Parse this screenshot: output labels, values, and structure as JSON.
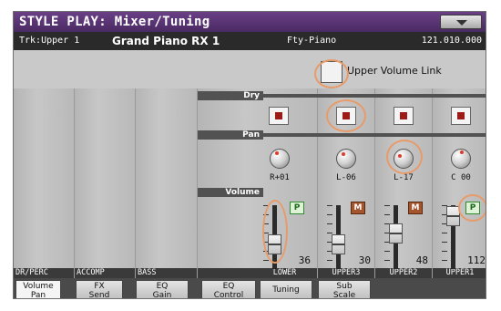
{
  "title": "STYLE PLAY: Mixer/Tuning",
  "info": {
    "track": "Trk:Upper 1",
    "sound": "Grand Piano RX 1",
    "bank": "Fty-Piano",
    "number": "121.010.000"
  },
  "upper_volume_link": "Upper Volume Link",
  "sections": {
    "dry": "Dry",
    "pan": "Pan",
    "volume": "Volume"
  },
  "channels": [
    {
      "name": "DR/PERC"
    },
    {
      "name": "ACCOMP"
    },
    {
      "name": "BASS"
    },
    {
      "name": "LOWER",
      "volume": "36",
      "button": "P"
    },
    {
      "name": "UPPER3",
      "pan": "L-06",
      "volume": "30",
      "button": "M"
    },
    {
      "name": "UPPER2",
      "pan": "L-17",
      "volume": "48",
      "button": "M"
    },
    {
      "name": "UPPER1",
      "pan": "C 00",
      "volume": "112",
      "button": "P"
    }
  ],
  "lower_pan": "R+01",
  "tabs": [
    {
      "line1": "Volume",
      "line2": "Pan"
    },
    {
      "line1": "FX",
      "line2": "Send"
    },
    {
      "line1": "EQ",
      "line2": "Gain"
    },
    {
      "line1": "EQ",
      "line2": "Control"
    },
    {
      "line1": "Tuning",
      "line2": ""
    },
    {
      "line1": "Sub",
      "line2": "Scale"
    }
  ],
  "colors": {
    "title_bar": "#5a3575",
    "highlight_ring": "#e89b6a",
    "mute_red": "#9c1b18",
    "play_green": "#2e8a2e"
  }
}
